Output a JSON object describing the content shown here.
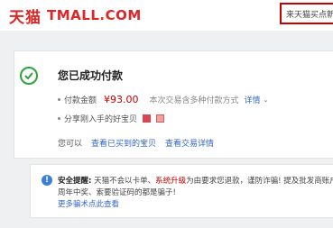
{
  "header": {
    "logo_cn": "天猫",
    "logo_en": "TMALL.COM",
    "search_placeholder": "来天猫买点新鲜"
  },
  "payment": {
    "title": "您已成功付款",
    "amount_label": "付款金额",
    "amount_value": "¥93.00",
    "amount_note": "本次交易含多种付款方式",
    "details_link": "详情",
    "share_label": "分享刚入手的好宝贝",
    "you_can": "您可以",
    "view_purchased": "查看已买到的宝贝",
    "view_trade": "查看交易详情"
  },
  "notice": {
    "heading": "安全提醒:",
    "line1_a": "天猫不会以卡单、",
    "line1_red": "系统升级",
    "line1_b": "为由要求您退款，谨防诈骗! 提及批发商账户",
    "line2": "周年中奖、索要验证码的都是骗子!",
    "line3_link": "更多骗术点此查看"
  }
}
